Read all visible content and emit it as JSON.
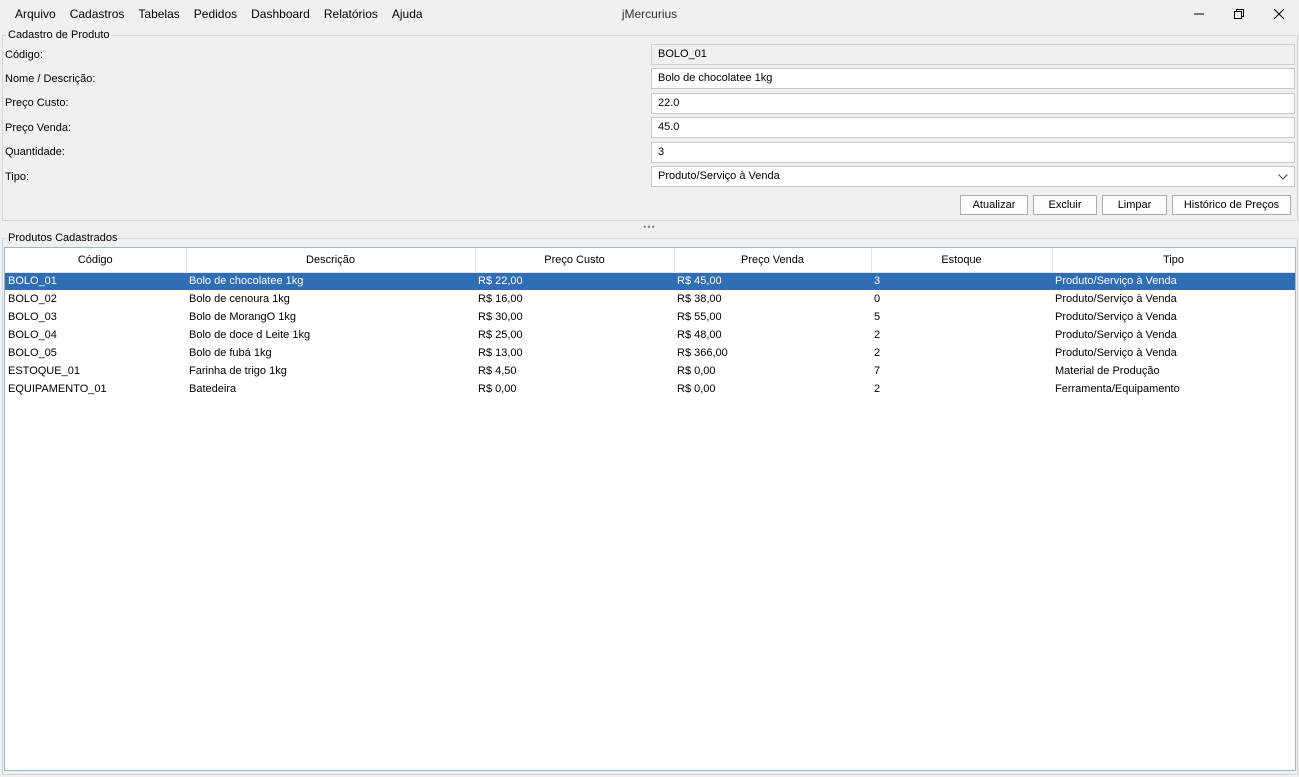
{
  "menu": [
    "Arquivo",
    "Cadastros",
    "Tabelas",
    "Pedidos",
    "Dashboard",
    "Relatórios",
    "Ajuda"
  ],
  "window": {
    "title": "jMercurius",
    "minimize": "—",
    "maximize": "❐",
    "close": "✕"
  },
  "form": {
    "legend": "Cadastro de Produto",
    "codigo_label": "Código:",
    "codigo_value": "BOLO_01",
    "nome_label": "Nome / Descrição:",
    "nome_value": "Bolo de chocolatee 1kg",
    "custo_label": "Preço Custo:",
    "custo_value": "22.0",
    "venda_label": "Preço Venda:",
    "venda_value": "45.0",
    "qtd_label": "Quantidade:",
    "qtd_value": "3",
    "tipo_label": "Tipo:",
    "tipo_value": "Produto/Serviço à Venda"
  },
  "buttons": {
    "atualizar": "Atualizar",
    "excluir": "Excluir",
    "limpar": "Limpar",
    "historico": "Histórico de Preços"
  },
  "splitter_grip": "•••",
  "table": {
    "legend": "Produtos Cadastrados",
    "columns": [
      "Código",
      "Descrição",
      "Preço Custo",
      "Preço Venda",
      "Estoque",
      "Tipo"
    ],
    "rows": [
      [
        "BOLO_01",
        "Bolo de chocolatee 1kg",
        "R$ 22,00",
        "R$ 45,00",
        "3",
        "Produto/Serviço à Venda"
      ],
      [
        "BOLO_02",
        "Bolo de cenoura 1kg",
        "R$ 16,00",
        "R$ 38,00",
        "0",
        "Produto/Serviço à Venda"
      ],
      [
        "BOLO_03",
        "Bolo de MorangO 1kg",
        "R$ 30,00",
        "R$ 55,00",
        "5",
        "Produto/Serviço à Venda"
      ],
      [
        "BOLO_04",
        "Bolo de doce d Leite 1kg",
        "R$ 25,00",
        "R$ 48,00",
        "2",
        "Produto/Serviço à Venda"
      ],
      [
        "BOLO_05",
        "Bolo de fubá 1kg",
        "R$ 13,00",
        "R$ 366,00",
        "2",
        "Produto/Serviço à Venda"
      ],
      [
        "ESTOQUE_01",
        "Farinha de trigo 1kg",
        "R$ 4,50",
        "R$ 0,00",
        "7",
        "Material de Produção"
      ],
      [
        "EQUIPAMENTO_01",
        "Batedeira",
        "R$ 0,00",
        "R$ 0,00",
        "2",
        "Ferramenta/Equipamento"
      ]
    ],
    "selected_row": 0
  },
  "colors": {
    "selection": "#2f6db5",
    "background": "#f0f0f0"
  },
  "icons": {
    "minimize": "minimize-icon",
    "maximize": "maximize-icon",
    "close": "close-icon",
    "dropdown": "chevron-down-icon"
  }
}
